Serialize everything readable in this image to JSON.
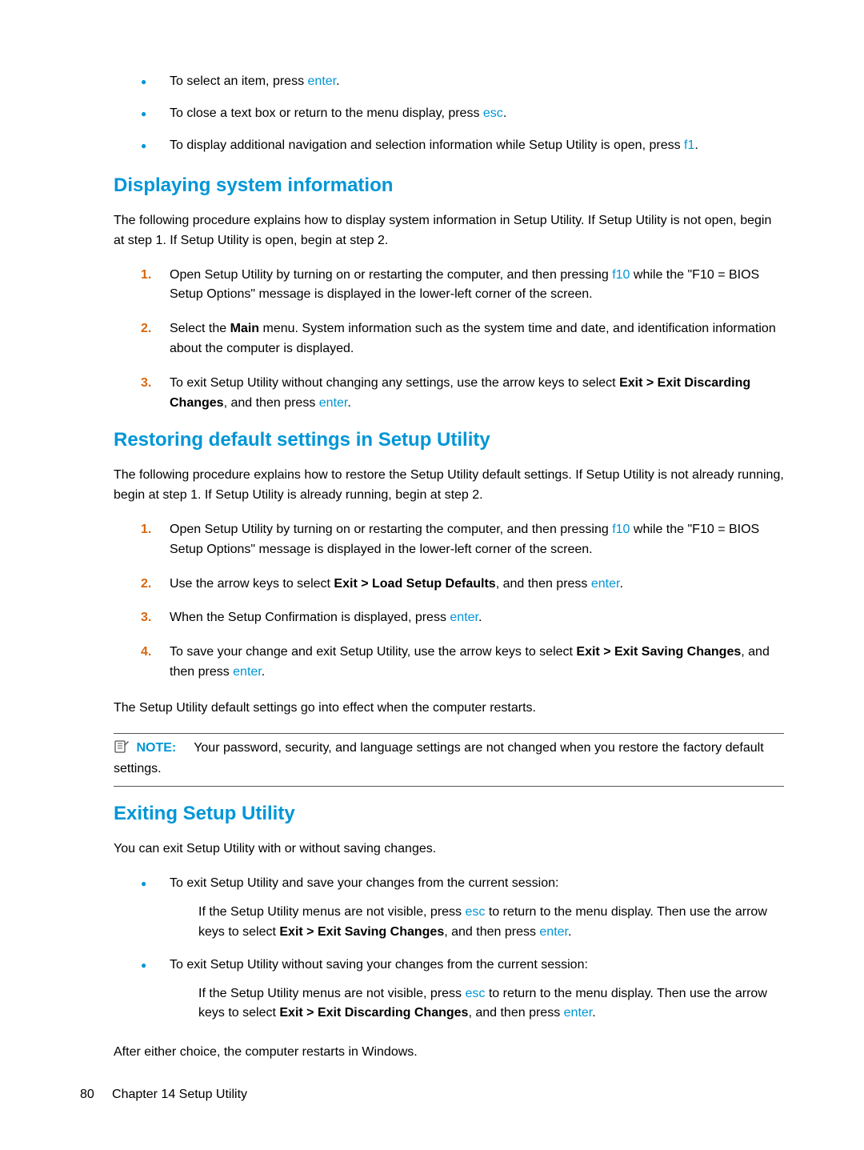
{
  "intro_bullets": [
    {
      "pre": "To select an item, press ",
      "key": "enter",
      "post": "."
    },
    {
      "pre": "To close a text box or return to the menu display, press ",
      "key": "esc",
      "post": "."
    },
    {
      "pre": "To display additional navigation and selection information while Setup Utility is open, press ",
      "key": "f1",
      "post": "."
    }
  ],
  "section1": {
    "heading": "Displaying system information",
    "intro": "The following procedure explains how to display system information in Setup Utility. If Setup Utility is not open, begin at step 1. If Setup Utility is open, begin at step 2.",
    "steps": {
      "s1_pre": "Open Setup Utility by turning on or restarting the computer, and then pressing ",
      "s1_key": "f10",
      "s1_post": " while the \"F10 = BIOS Setup Options\" message is displayed in the lower-left corner of the screen.",
      "s2_pre": "Select the ",
      "s2_bold": "Main",
      "s2_post": " menu. System information such as the system time and date, and identification information about the computer is displayed.",
      "s3_pre": "To exit Setup Utility without changing any settings, use the arrow keys to select ",
      "s3_bold": "Exit > Exit Discarding Changes",
      "s3_mid": ", and then press ",
      "s3_key": "enter",
      "s3_post": "."
    }
  },
  "section2": {
    "heading": "Restoring default settings in Setup Utility",
    "intro": "The following procedure explains how to restore the Setup Utility default settings. If Setup Utility is not already running, begin at step 1. If Setup Utility is already running, begin at step 2.",
    "steps": {
      "s1_pre": "Open Setup Utility by turning on or restarting the computer, and then pressing ",
      "s1_key": "f10",
      "s1_post": " while the \"F10 = BIOS Setup Options\" message is displayed in the lower-left corner of the screen.",
      "s2_pre": "Use the arrow keys to select ",
      "s2_bold": "Exit > Load Setup Defaults",
      "s2_mid": ", and then press ",
      "s2_key": "enter",
      "s2_post": ".",
      "s3_pre": "When the Setup Confirmation is displayed, press ",
      "s3_key": "enter",
      "s3_post": ".",
      "s4_pre": "To save your change and exit Setup Utility, use the arrow keys to select ",
      "s4_bold": "Exit > Exit Saving Changes",
      "s4_mid": ", and then press ",
      "s4_key": "enter",
      "s4_post": "."
    },
    "outro": "The Setup Utility default settings go into effect when the computer restarts.",
    "note_label": "NOTE:",
    "note_text": "Your password, security, and language settings are not changed when you restore the factory default settings."
  },
  "section3": {
    "heading": "Exiting Setup Utility",
    "intro": "You can exit Setup Utility with or without saving changes.",
    "b1_text": "To exit Setup Utility and save your changes from the current session:",
    "b1_sub_pre": "If the Setup Utility menus are not visible, press ",
    "b1_sub_key1": "esc",
    "b1_sub_mid": " to return to the menu display. Then use the arrow keys to select ",
    "b1_sub_bold": "Exit > Exit Saving Changes",
    "b1_sub_mid2": ", and then press ",
    "b1_sub_key2": "enter",
    "b1_sub_post": ".",
    "b2_text": "To exit Setup Utility without saving your changes from the current session:",
    "b2_sub_pre": "If the Setup Utility menus are not visible, press ",
    "b2_sub_key1": "esc",
    "b2_sub_mid": " to return to the menu display. Then use the arrow keys to select ",
    "b2_sub_bold": "Exit > Exit Discarding Changes",
    "b2_sub_mid2": ", and then press ",
    "b2_sub_key2": "enter",
    "b2_sub_post": ".",
    "outro": "After either choice, the computer restarts in Windows."
  },
  "footer": {
    "page_number": "80",
    "chapter": "Chapter 14   Setup Utility"
  }
}
